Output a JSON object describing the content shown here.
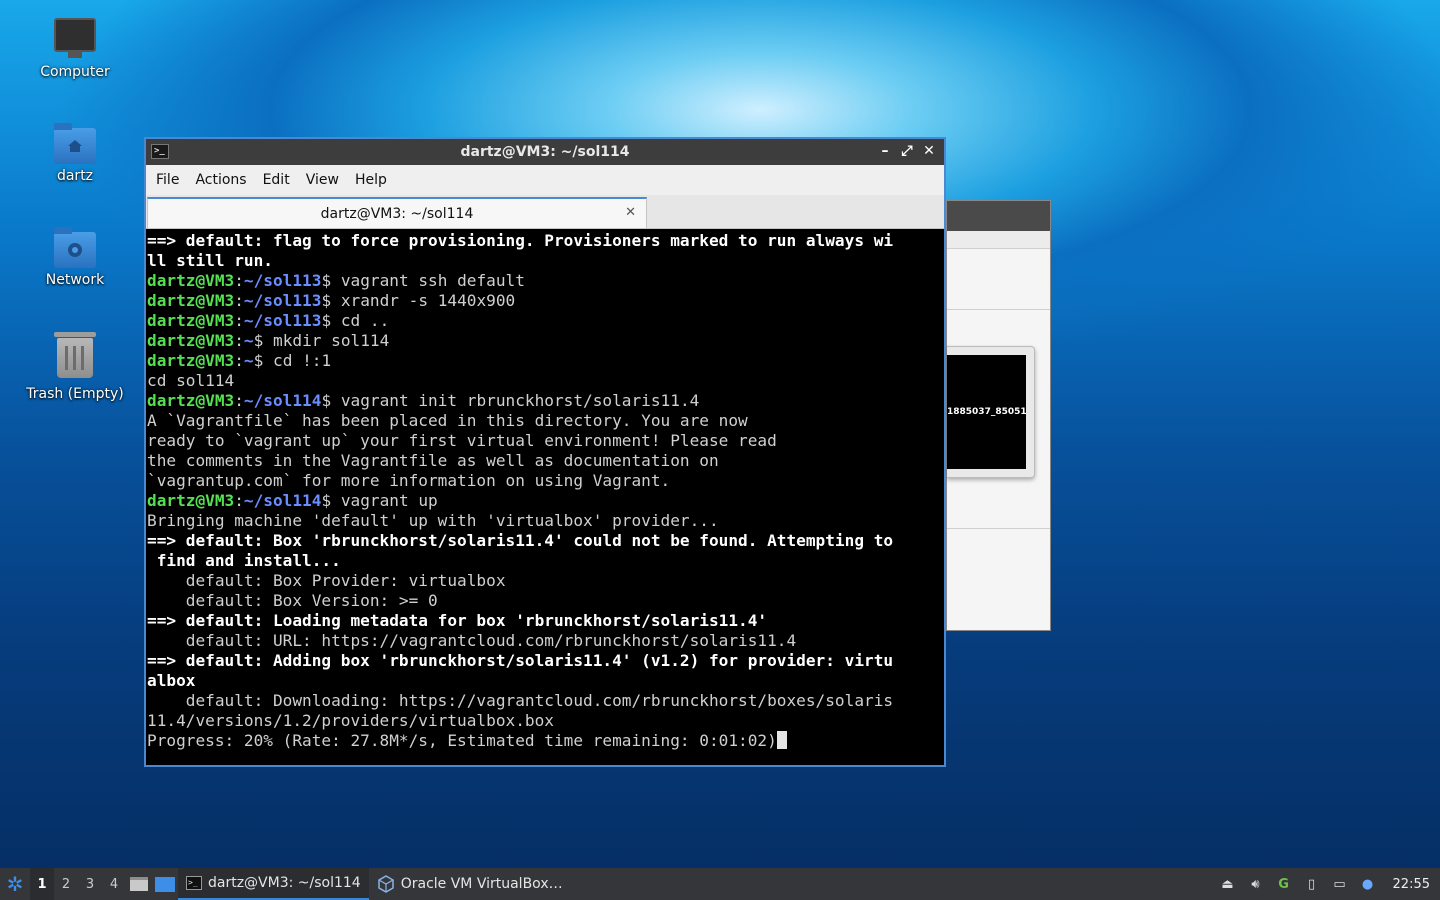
{
  "desktop": {
    "icons": [
      {
        "label": "Computer"
      },
      {
        "label": "dartz"
      },
      {
        "label": "Network"
      },
      {
        "label": "Trash (Empty)"
      }
    ]
  },
  "background_window": {
    "thumbnail_label": "1885037_85051"
  },
  "terminal": {
    "title": "dartz@VM3: ~/sol114",
    "menu": [
      "File",
      "Actions",
      "Edit",
      "View",
      "Help"
    ],
    "tab_title": "dartz@VM3: ~/sol114",
    "lines": [
      "==> default: flag to force provisioning. Provisioners marked to run always wi",
      "ll still run.",
      "dartz@VM3:~/sol113$ vagrant ssh default",
      "dartz@VM3:~/sol113$ xrandr -s 1440x900",
      "dartz@VM3:~/sol113$ cd ..",
      "dartz@VM3:~$ mkdir sol114",
      "dartz@VM3:~$ cd !:1",
      "cd sol114",
      "dartz@VM3:~/sol114$ vagrant init rbrunckhorst/solaris11.4",
      "A `Vagrantfile` has been placed in this directory. You are now",
      "ready to `vagrant up` your first virtual environment! Please read",
      "the comments in the Vagrantfile as well as documentation on",
      "`vagrantup.com` for more information on using Vagrant.",
      "dartz@VM3:~/sol114$ vagrant up",
      "Bringing machine 'default' up with 'virtualbox' provider...",
      "==> default: Box 'rbrunckhorst/solaris11.4' could not be found. Attempting to",
      " find and install...",
      "    default: Box Provider: virtualbox",
      "    default: Box Version: >= 0",
      "==> default: Loading metadata for box 'rbrunckhorst/solaris11.4'",
      "    default: URL: https://vagrantcloud.com/rbrunckhorst/solaris11.4",
      "==> default: Adding box 'rbrunckhorst/solaris11.4' (v1.2) for provider: virtu",
      "albox",
      "    default: Downloading: https://vagrantcloud.com/rbrunckhorst/boxes/solaris",
      "11.4/versions/1.2/providers/virtualbox.box",
      "Progress: 20% (Rate: 27.8M*/s, Estimated time remaining: 0:01:02)"
    ]
  },
  "taskbar": {
    "workspaces": [
      "1",
      "2",
      "3",
      "4"
    ],
    "active_workspace": "1",
    "tasks": [
      {
        "label": "dartz@VM3: ~/sol114",
        "active": true
      },
      {
        "label": "Oracle VM VirtualBox…",
        "active": false
      }
    ],
    "clock": "22:55"
  },
  "colors": {
    "prompt_user": "#55e052",
    "prompt_path": "#6a8dff",
    "accent": "#4a88d2"
  }
}
